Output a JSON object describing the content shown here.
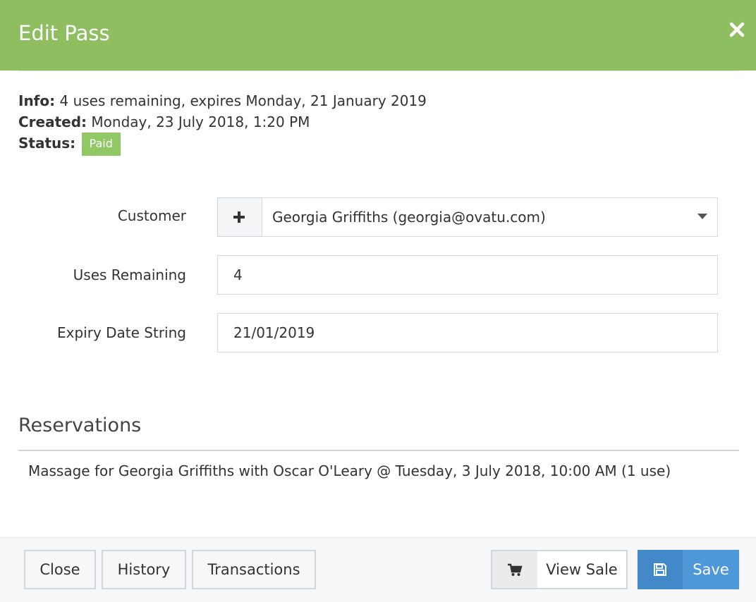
{
  "modal": {
    "title": "Edit Pass",
    "close_icon": "close-icon"
  },
  "info": {
    "info_label": "Info:",
    "info_value": "4 uses remaining, expires Monday, 21 January 2019",
    "created_label": "Created:",
    "created_value": "Monday, 23 July 2018, 1:20 PM",
    "status_label": "Status:",
    "status_value": "Paid",
    "status_color": "#8fc864"
  },
  "form": {
    "customer_label": "Customer",
    "customer_value": "Georgia Griffiths (georgia@ovatu.com)",
    "add_customer_icon": "plus-icon",
    "uses_label": "Uses Remaining",
    "uses_value": "4",
    "expiry_label": "Expiry Date String",
    "expiry_value": "21/01/2019"
  },
  "reservations": {
    "title": "Reservations",
    "items": [
      "Massage for Georgia Griffiths with Oscar O'Leary @ Tuesday, 3 July 2018, 10:00 AM (1 use)"
    ]
  },
  "footer": {
    "close_label": "Close",
    "history_label": "History",
    "transactions_label": "Transactions",
    "view_sale_label": "View Sale",
    "view_sale_icon": "cart-icon",
    "save_label": "Save",
    "save_icon": "floppy-disk-icon"
  },
  "colors": {
    "header_bg": "#8fbe61",
    "save_bg": "#4e97d8"
  }
}
